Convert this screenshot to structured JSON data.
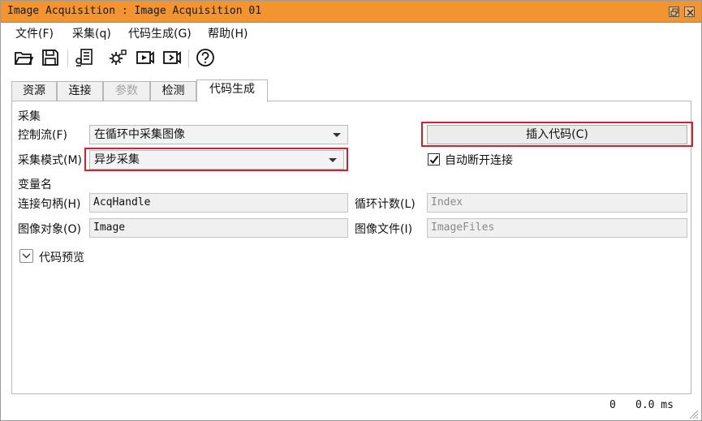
{
  "window": {
    "title": "Image Acquisition : Image Acquisition 01"
  },
  "menu": [
    "文件(F)",
    "采集(q)",
    "代码生成(G)",
    "帮助(H)"
  ],
  "toolbar": {
    "buttons": [
      "open-folder-icon",
      "save-icon",
      "list-settings-icon",
      "gear-device-icon",
      "live-video-icon",
      "snap-video-icon",
      "help-icon"
    ]
  },
  "tabs": [
    {
      "label": "资源",
      "state": "normal"
    },
    {
      "label": "连接",
      "state": "normal"
    },
    {
      "label": "参数",
      "state": "disabled"
    },
    {
      "label": "检测",
      "state": "normal"
    },
    {
      "label": "代码生成",
      "state": "active"
    }
  ],
  "acquisition": {
    "section": "采集",
    "control_flow_label": "控制流(F)",
    "control_flow_value": "在循环中采集图像",
    "mode_label": "采集模式(M)",
    "mode_value": "异步采集",
    "insert_button": "插入代码(C)",
    "auto_disconnect_label": "自动断开连接",
    "auto_disconnect_checked": true
  },
  "variables": {
    "section": "变量名",
    "handle_label": "连接句柄(H)",
    "handle_value": "AcqHandle",
    "image_label": "图像对象(O)",
    "image_value": "Image",
    "loop_label": "循环计数(L)",
    "loop_placeholder": "Index",
    "files_label": "图像文件(I)",
    "files_placeholder": "ImageFiles"
  },
  "preview": {
    "label": "代码预览",
    "expanded": false
  },
  "status": {
    "count": "0",
    "time": "0.0 ms"
  },
  "colors": {
    "titlebar": "#f29430",
    "highlight": "#d4202a"
  }
}
